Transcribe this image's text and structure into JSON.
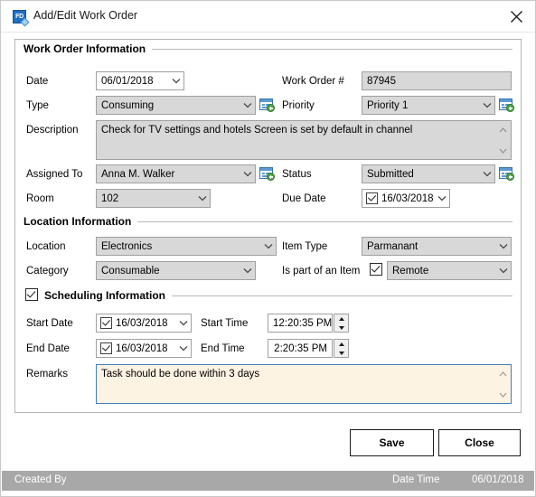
{
  "window": {
    "title": "Add/Edit Work Order",
    "app_icon": "FD",
    "close_icon": "close-icon"
  },
  "sections": {
    "work_order": "Work Order Information",
    "location": "Location Information",
    "scheduling": "Scheduling Information"
  },
  "work_order": {
    "date_label": "Date",
    "date_value": "06/01/2018",
    "wo_number_label": "Work Order #",
    "wo_number_value": "87945",
    "type_label": "Type",
    "type_value": "Consuming",
    "priority_label": "Priority",
    "priority_value": "Priority 1",
    "description_label": "Description",
    "description_value": "Check for TV settings and hotels Screen is set by default in channel",
    "assigned_to_label": "Assigned To",
    "assigned_to_value": "Anna M. Walker",
    "status_label": "Status",
    "status_value": "Submitted",
    "room_label": "Room",
    "room_value": "102",
    "due_date_label": "Due Date",
    "due_date_value": "16/03/2018",
    "due_date_checked": true
  },
  "location": {
    "location_label": "Location",
    "location_value": "Electronics",
    "item_type_label": "Item Type",
    "item_type_value": "Parmanant",
    "category_label": "Category",
    "category_value": "Consumable",
    "is_part_label": "Is part of an Item",
    "is_part_checked": true,
    "is_part_value": "Remote"
  },
  "scheduling": {
    "enabled": true,
    "start_date_label": "Start Date",
    "start_date_value": "16/03/2018",
    "start_date_checked": true,
    "start_time_label": "Start Time",
    "start_time_value": "12:20:35 PM",
    "end_date_label": "End Date",
    "end_date_value": "16/03/2018",
    "end_date_checked": true,
    "end_time_label": "End Time",
    "end_time_value": "2:20:35 PM",
    "remarks_label": "Remarks",
    "remarks_value": "Task should be done within 3 days"
  },
  "buttons": {
    "save": "Save",
    "close": "Close"
  },
  "statusbar": {
    "created_by": "Created By",
    "date_time_label": "Date Time",
    "date_time_value": "06/01/2018"
  },
  "colors": {
    "control_fill": "#d8d8d8",
    "remarks_fill": "#fdf3e3",
    "remarks_border": "#3f7fbf",
    "statusbar_bg": "#a8a8a8",
    "accent_blue": "#1f6fc4",
    "plus_green": "#4fa544"
  }
}
